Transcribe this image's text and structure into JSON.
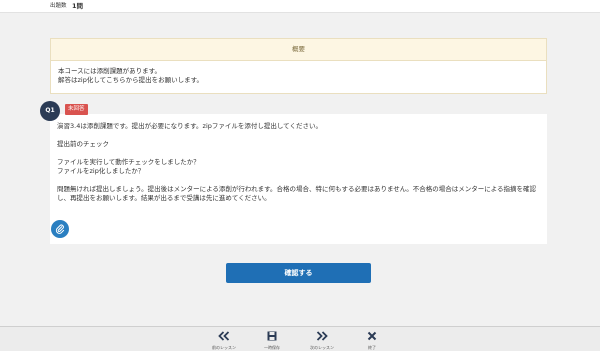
{
  "header": {
    "question_label": "出題数",
    "question_count": "1問"
  },
  "summary": {
    "title": "概要",
    "lines": [
      "本コースには添削課題があります。",
      "解答はzip化してこちらから提出をお願いします。"
    ]
  },
  "question": {
    "number": "Q1",
    "status": "未回答",
    "paragraphs": [
      "演習3.4は添削課題です。提出が必要になります。zipファイルを添付し提出してください。",
      "提出前のチェック",
      "ファイルを実行して動作チェックをしましたか？",
      "ファイルをzip化しましたか？",
      "問題無ければ提出しましょう。提出後はメンターによる添削が行われます。合格の場合、特に何もする必要はありません。不合格の場合はメンターによる指摘を確認し、再提出をお願いします。結果が出るまで受講は先に進めてください。"
    ],
    "attach_icon": "paperclip-icon"
  },
  "actions": {
    "confirm_label": "確認する"
  },
  "bottom_nav": {
    "items": [
      {
        "icon": "double-chevron-left-icon",
        "label": "前のレッスン"
      },
      {
        "icon": "save-icon",
        "label": "一時保存"
      },
      {
        "icon": "double-chevron-right-icon",
        "label": "次のレッスン"
      },
      {
        "icon": "close-icon",
        "label": "終了"
      }
    ]
  },
  "colors": {
    "accent": "#1f6fb5",
    "badge": "#d9534f",
    "summary_header": "#fdf6e3",
    "question_circle": "#2b3b55"
  }
}
